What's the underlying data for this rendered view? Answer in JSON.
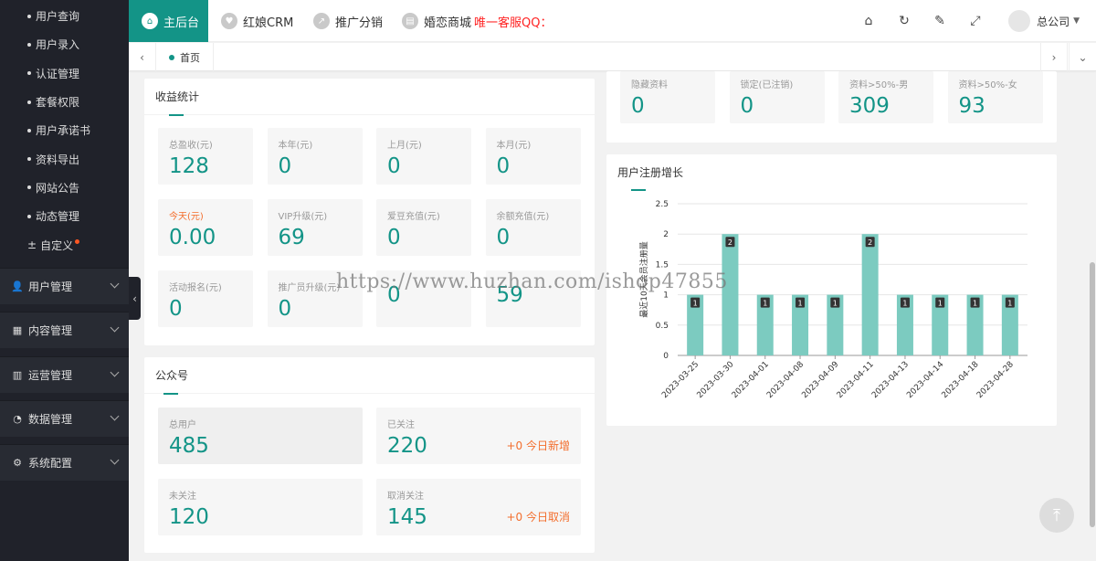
{
  "sidebar": {
    "sub_items": [
      "用户查询",
      "用户录入",
      "认证管理",
      "套餐权限",
      "用户承诺书",
      "资料导出",
      "网站公告",
      "动态管理"
    ],
    "custom_label": "自定义",
    "groups": [
      {
        "label": "用户管理",
        "icon": "users-icon"
      },
      {
        "label": "内容管理",
        "icon": "content-icon"
      },
      {
        "label": "运营管理",
        "icon": "bar-chart-icon"
      },
      {
        "label": "数据管理",
        "icon": "pie-chart-icon"
      },
      {
        "label": "系统配置",
        "icon": "gear-icon"
      }
    ]
  },
  "header": {
    "tabs": [
      "主后台",
      "红娘CRM",
      "推广分销",
      "婚恋商城"
    ],
    "qq_text": "唯一客服QQ：",
    "user_name": "总公司"
  },
  "page_tabs": {
    "home": "首页"
  },
  "income": {
    "title": "收益统计",
    "stats": [
      {
        "label": "总盈收(元)",
        "value": "128"
      },
      {
        "label": "本年(元)",
        "value": "0"
      },
      {
        "label": "上月(元)",
        "value": "0"
      },
      {
        "label": "本月(元)",
        "value": "0"
      },
      {
        "label": "今天(元)",
        "value": "0.00"
      },
      {
        "label": "VIP升级(元)",
        "value": "69"
      },
      {
        "label": "爱豆充值(元)",
        "value": "0"
      },
      {
        "label": "余额充值(元)",
        "value": "0"
      },
      {
        "label": "活动报名(元)",
        "value": "0"
      },
      {
        "label": "推广员升级(元)",
        "value": "0"
      },
      {
        "label": "",
        "value": "0"
      },
      {
        "label": "",
        "value": "59"
      }
    ]
  },
  "wechat": {
    "title": "公众号",
    "stats": [
      {
        "label": "总用户",
        "value": "485",
        "note": ""
      },
      {
        "label": "已关注",
        "value": "220",
        "note": "+0 今日新增"
      },
      {
        "label": "未关注",
        "value": "120",
        "note": ""
      },
      {
        "label": "取消关注",
        "value": "145",
        "note": "+0 今日取消"
      }
    ]
  },
  "profile_stats": [
    {
      "label": "隐藏资料",
      "value": "0"
    },
    {
      "label": "锁定(已注销)",
      "value": "0"
    },
    {
      "label": "资料>50%-男",
      "value": "309"
    },
    {
      "label": "资料>50%-女",
      "value": "93"
    }
  ],
  "reg_chart_title": "用户注册增长",
  "chart_data": {
    "type": "bar",
    "categories": [
      "2023-03-25",
      "2023-03-30",
      "2023-04-01",
      "2023-04-08",
      "2023-04-09",
      "2023-04-11",
      "2023-04-13",
      "2023-04-14",
      "2023-04-18",
      "2023-04-28"
    ],
    "values": [
      1,
      2,
      1,
      1,
      1,
      2,
      1,
      1,
      1,
      1
    ],
    "ylabel": "最近10天会员注册量",
    "ylim": [
      0,
      2.5
    ],
    "yticks": [
      "0",
      "0.5",
      "1",
      "1.5",
      "2",
      "2.5"
    ],
    "bar_color": "#7ccbc0",
    "grid": true
  },
  "watermark": "https://www.huzhan.com/ishop47855",
  "colors": {
    "accent": "#139487",
    "orange": "#f36e2d",
    "sidebar": "#20222a"
  }
}
